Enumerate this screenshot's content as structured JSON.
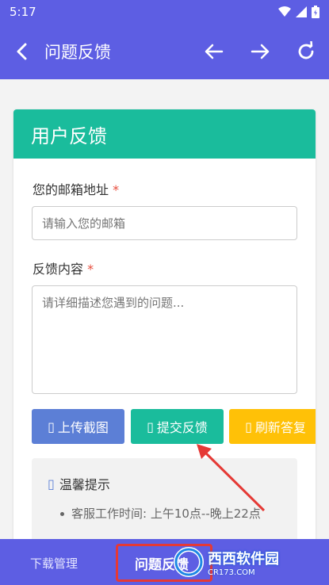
{
  "status": {
    "time": "5:17"
  },
  "toolbar": {
    "title": "问题反馈"
  },
  "card": {
    "header": "用户反馈",
    "email_label": "您的邮箱地址",
    "required_mark": "*",
    "email_placeholder": "请输入您的邮箱",
    "content_label": "反馈内容",
    "content_placeholder": "请详细描述您遇到的问题..."
  },
  "buttons": {
    "upload": "上传截图",
    "submit": "提交反馈",
    "refresh": "刷新答复",
    "icon_glyph": "▯"
  },
  "tips": {
    "title": "温馨提示",
    "icon_glyph": "▯",
    "item1": "客服工作时间: 上午10点--晚上22点"
  },
  "tabs": {
    "downloads": "下载管理",
    "feedback": "问题反馈"
  },
  "watermark": {
    "brand": "西西软件园",
    "url": "CR173.COM"
  },
  "colors": {
    "primary": "#5d5ee3",
    "teal": "#1abc9c",
    "upload": "#5c7fd6",
    "refresh": "#ffc107",
    "required": "#e74c3c",
    "annotation": "#e53935"
  }
}
